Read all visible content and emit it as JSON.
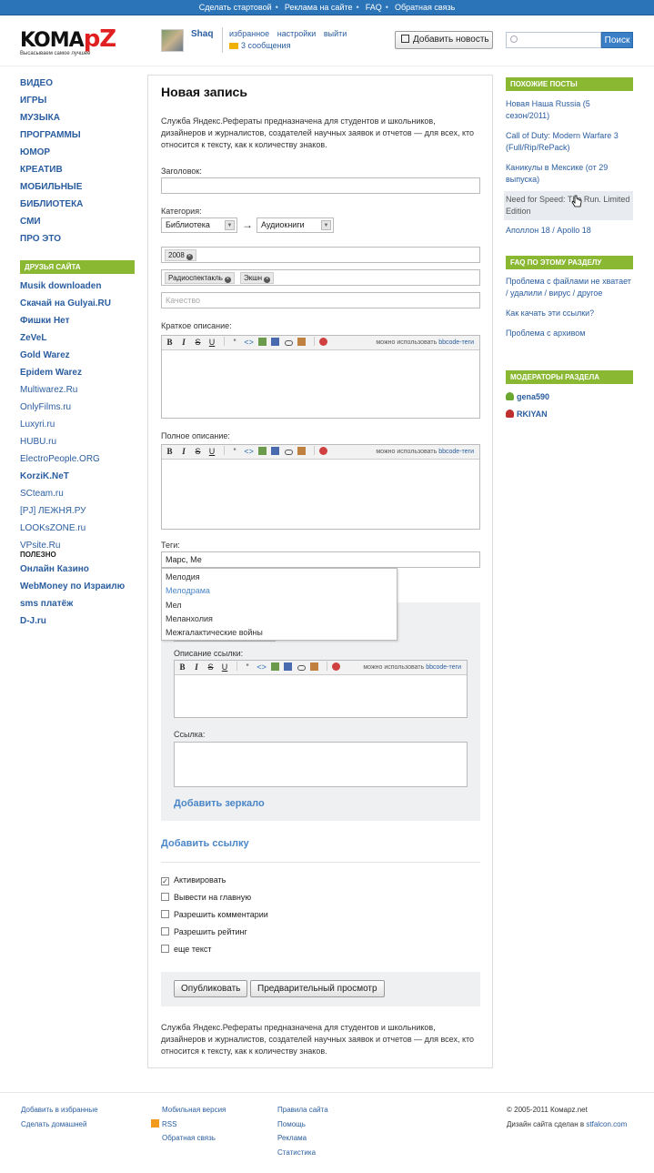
{
  "topbar": {
    "links": [
      "Сделать стартовой",
      "Реклама на сайте",
      "FAQ",
      "Обратная связь"
    ]
  },
  "logo": {
    "text_a": "KOMA",
    "text_b": "pZ",
    "slogan": "Высасываем самое лучшее"
  },
  "user": {
    "name": "Shaq",
    "menu": [
      "избранное",
      "настройки",
      "выйти"
    ],
    "messages": "3 сообщения"
  },
  "header": {
    "add_news_label": "Добавить новость",
    "search_placeholder": "",
    "search_button": "Поиск"
  },
  "nav": {
    "categories": [
      "ВИДЕО",
      "ИГРЫ",
      "МУЗЫКА",
      "ПРОГРАММЫ",
      "ЮМОР",
      "КРЕАТИВ",
      "МОБИЛЬНЫЕ",
      "БИБЛИОТЕКА",
      "СМИ",
      "ПРО ЭТО"
    ]
  },
  "friends": {
    "heading": "ДРУЗЬЯ САЙТА",
    "items": [
      {
        "label": "Musik downloaden",
        "bold": true
      },
      {
        "label": "Скачай на Gulyai.RU",
        "bold": true
      },
      {
        "label": "Фишки Нет",
        "bold": true
      },
      {
        "label": "ZeVeL",
        "bold": true
      },
      {
        "label": "Gold Warez",
        "bold": true
      },
      {
        "label": "Epidem Warez",
        "bold": true
      },
      {
        "label": "Multiwarez.Ru",
        "bold": false
      },
      {
        "label": "OnlyFilms.ru",
        "bold": false
      },
      {
        "label": "Luxyri.ru",
        "bold": false
      },
      {
        "label": "HUBU.ru ElectroPeople.ORG",
        "bold": false
      },
      {
        "label": "KorziK.NeT",
        "bold": true
      },
      {
        "label": "SCteam.ru",
        "bold": false
      },
      {
        "label": "[PJ] ЛЕЖНЯ.РУ",
        "bold": false
      },
      {
        "label": "LOOKsZONE.ru",
        "bold": false
      },
      {
        "label": "VPsite.Ru",
        "bold": false
      }
    ]
  },
  "useful": {
    "heading": "ПОЛЕЗНО",
    "items": [
      "Онлайн Казино",
      "WebMoney по Израилю",
      "sms платёж",
      "D-J.ru"
    ]
  },
  "form": {
    "title": "Новая запись",
    "intro": "Служба Яндекс.Рефераты предназначена для студентов и школьников, дизайнеров и журналистов, создателей научных заявок и отчетов — для всех, кто относится к тексту, как к количеству знаков.",
    "title_label": "Заголовок:",
    "title_value": "",
    "category_label": "Категория:",
    "category": "Библиотека",
    "subcategory": "Аудиокниги",
    "arrow": "→",
    "year_tags": [
      "2008"
    ],
    "genre_tags": [
      "Радиоспектакль",
      "Экшн"
    ],
    "quality_placeholder": "Качество",
    "short_label": "Краткое описание:",
    "full_label": "Полное описание:",
    "bbcode_hint": "можно использовать",
    "bbcode_link": "bbcode-теги",
    "toolbar": [
      "B",
      "I",
      "S",
      "U",
      "“",
      "<>"
    ],
    "tags_label": "Теги:",
    "tags_value": "Марс, Ме",
    "suggestions": [
      "Мелодия",
      "Мелодрама",
      "Мел",
      "Меланхолия",
      "Межгалактические войны"
    ],
    "link_desc_label": "Описание ссылки:",
    "link_label": "Ссылка:",
    "add_mirror": "Добавить зеркало",
    "add_link": "Добавить ссылку",
    "checkboxes": [
      {
        "label": "Активировать",
        "checked": true
      },
      {
        "label": "Вывести на главную",
        "checked": false
      },
      {
        "label": "Разрешить комментарии",
        "checked": false
      },
      {
        "label": "Разрешить рейтинг",
        "checked": false
      },
      {
        "label": "еще текст",
        "checked": false
      }
    ],
    "publish_button": "Опубликовать",
    "preview_button": "Предварительный просмотр",
    "outro": "Служба Яндекс.Рефераты предназначена для студентов и школьников, дизайнеров и журналистов, создателей научных заявок и отчетов — для всех, кто относится к тексту, как к количеству знаков."
  },
  "similar": {
    "heading": "ПОХОЖИЕ ПОСТЫ",
    "items": [
      "Новая Наша Russia (5 сезон/2011)",
      "Call of Duty: Modern Warfare 3 (Full/Rip/RePack)",
      "Каникулы в Мексике (от 29 выпуска)",
      "Need for Speed: The Run. Limited Edition",
      "Аполлон 18 / Apollo 18"
    ]
  },
  "faq": {
    "heading": "FAQ ПО ЭТОМУ РАЗДЕЛУ",
    "items": [
      "Проблема с файлами не хватает / удалили / вирус / другое",
      "Как качать эти ссылки?",
      "Проблема с архивом"
    ]
  },
  "moderators": {
    "heading": "МОДЕРАТОРЫ РАЗДЕЛА",
    "items": [
      {
        "name": "gena590",
        "color": "#6aa832"
      },
      {
        "name": "RKIYAN",
        "color": "#c03030"
      }
    ]
  },
  "footer": {
    "col1": [
      "Добавить в избранные",
      "Сделать домашней"
    ],
    "col2": [
      "Мобильная версия",
      "RSS",
      "Обратная связь"
    ],
    "col3": [
      "Правила сайта",
      "Помощь",
      "Реклама",
      "Статистика"
    ],
    "copyright": "© 2005-2011 Комарz.net",
    "design_text": "Дизайн сайта сделан в",
    "design_link": "stfalcon.com"
  },
  "colors": {
    "accent": "#2c74b8",
    "green": "#8ab832",
    "link": "#2a5d9f"
  }
}
